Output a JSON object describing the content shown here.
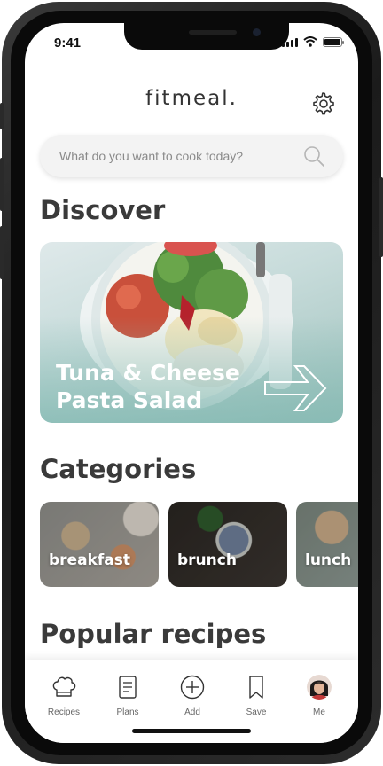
{
  "status": {
    "time": "9:41"
  },
  "header": {
    "brand": "fitmeal."
  },
  "search": {
    "placeholder": "What do you want to cook today?"
  },
  "discover": {
    "title": "Discover",
    "featured": {
      "title_line1": "Tuna & Cheese",
      "title_line2": "Pasta Salad"
    }
  },
  "categories": {
    "title": "Categories",
    "items": [
      {
        "label": "breakfast"
      },
      {
        "label": "brunch"
      },
      {
        "label": "lunch"
      }
    ]
  },
  "popular": {
    "title": "Popular recipes"
  },
  "tabbar": {
    "items": [
      {
        "label": "Recipes",
        "icon": "chef-hat-icon"
      },
      {
        "label": "Plans",
        "icon": "document-icon"
      },
      {
        "label": "Add",
        "icon": "plus-circle-icon"
      },
      {
        "label": "Save",
        "icon": "bookmark-icon"
      },
      {
        "label": "Me",
        "icon": "avatar"
      }
    ]
  },
  "colors": {
    "accent_teal": "#9fc2bd",
    "text_dark": "#3a3a3a",
    "tab_gray": "#666666"
  }
}
